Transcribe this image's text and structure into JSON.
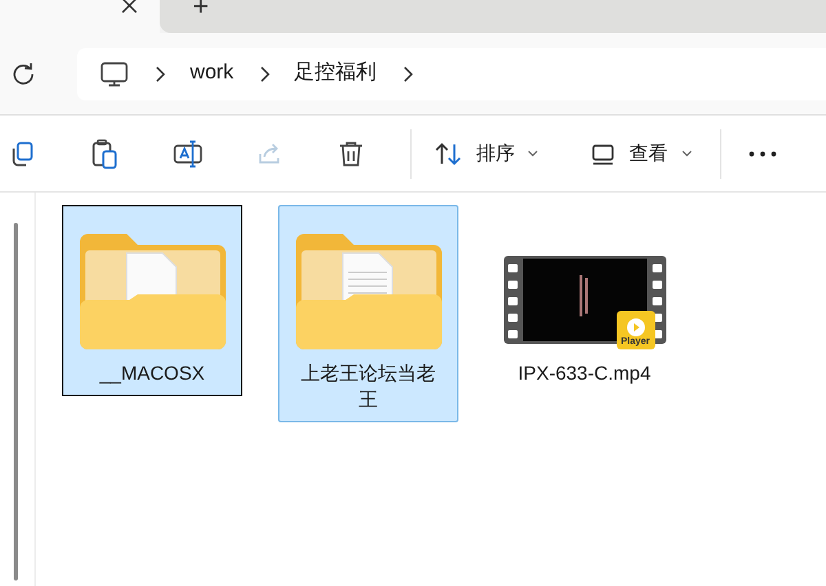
{
  "tab_strip": {
    "new_tab_glyph": "+"
  },
  "breadcrumb": [
    "work",
    "足控福利"
  ],
  "toolbar": {
    "sort": {
      "label": "排序"
    },
    "view": {
      "label": "查看"
    }
  },
  "items": [
    {
      "kind": "folder",
      "name": "__MACOSX",
      "selected": true,
      "focused": true
    },
    {
      "kind": "folder",
      "name": "上老王论坛当老王",
      "selected": true,
      "focused": false
    },
    {
      "kind": "video",
      "name": "IPX-633-C.mp4",
      "selected": false,
      "focused": false,
      "badge_label": "Player"
    }
  ]
}
